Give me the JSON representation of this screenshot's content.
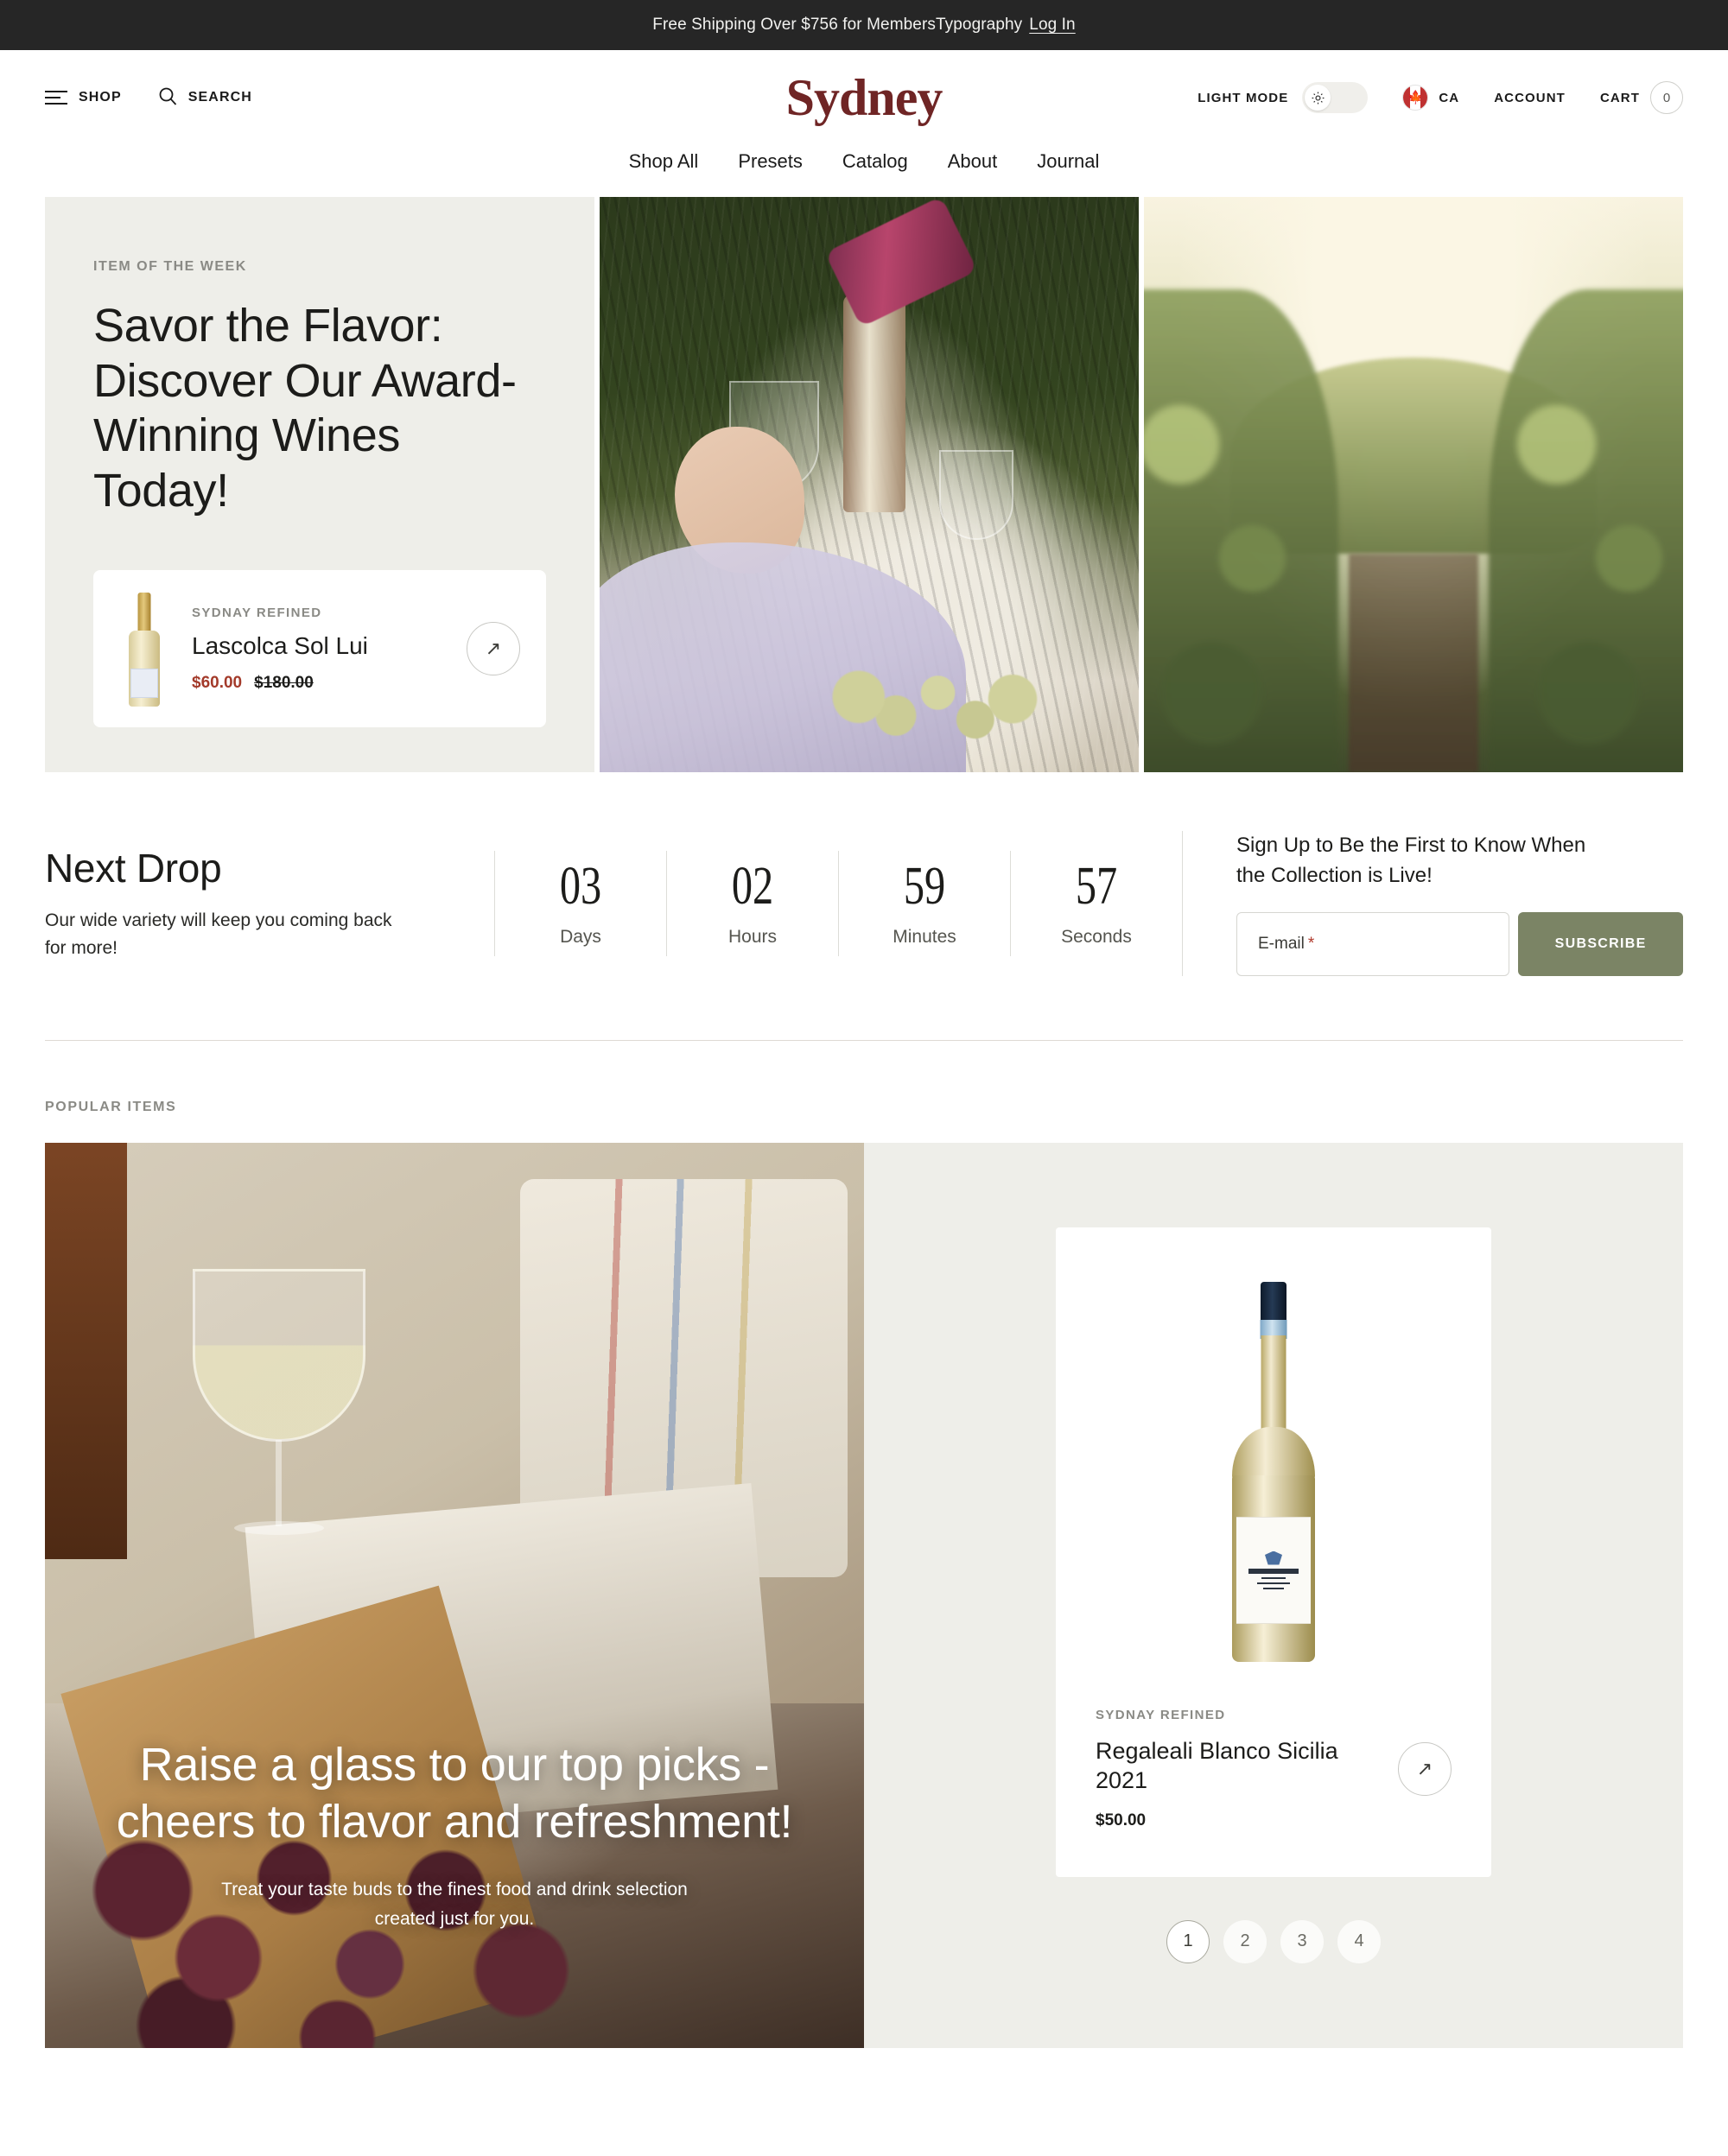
{
  "announcement": {
    "text": "Free Shipping Over $756 for MembersTypography",
    "login_label": "Log In"
  },
  "header": {
    "shop_label": "SHOP",
    "search_label": "SEARCH",
    "logo": "Sydney",
    "light_mode_label": "LIGHT MODE",
    "country_code": "CA",
    "account_label": "ACCOUNT",
    "cart_label": "CART",
    "cart_count": "0"
  },
  "mainnav": {
    "items": [
      {
        "label": "Shop All"
      },
      {
        "label": "Presets"
      },
      {
        "label": "Catalog"
      },
      {
        "label": "About"
      },
      {
        "label": "Journal"
      }
    ]
  },
  "hero": {
    "eyebrow": "ITEM OF THE WEEK",
    "title": "Savor the Flavor: Discover Our Award-Winning Wines Today!",
    "card": {
      "brand": "SYDNAY REFINED",
      "name": "Lascolca Sol Lui",
      "price_sale": "$60.00",
      "price_original": "$180.00",
      "arrow": "↗"
    }
  },
  "next_drop": {
    "title": "Next Drop",
    "subtitle": "Our wide variety will keep you coming back for more!",
    "countdown": [
      {
        "value": "03",
        "label": "Days"
      },
      {
        "value": "02",
        "label": "Hours"
      },
      {
        "value": "59",
        "label": "Minutes"
      },
      {
        "value": "57",
        "label": "Seconds"
      }
    ],
    "signup": {
      "title": "Sign Up to Be the First to Know When the Collection is Live!",
      "email_label": "E-mail",
      "required_mark": "*",
      "subscribe_label": "SUBSCRIBE"
    }
  },
  "popular": {
    "eyebrow": "POPULAR ITEMS",
    "promo": {
      "heading": "Raise a glass to our top picks - cheers to flavor and refreshment!",
      "subtext": "Treat your taste buds to the finest food and drink selection created just for you."
    },
    "product": {
      "brand": "SYDNAY REFINED",
      "name": "Regaleali Blanco Sicilia 2021",
      "price": "$50.00",
      "arrow": "↗"
    },
    "pagination": [
      {
        "label": "1"
      },
      {
        "label": "2"
      },
      {
        "label": "3"
      },
      {
        "label": "4"
      }
    ]
  },
  "colors": {
    "brand_maroon": "#6f2525",
    "sale_red": "#a33a2a",
    "panel_beige": "#eeeee9",
    "subscribe_green": "#7b8465",
    "announce_dark": "#262626"
  }
}
